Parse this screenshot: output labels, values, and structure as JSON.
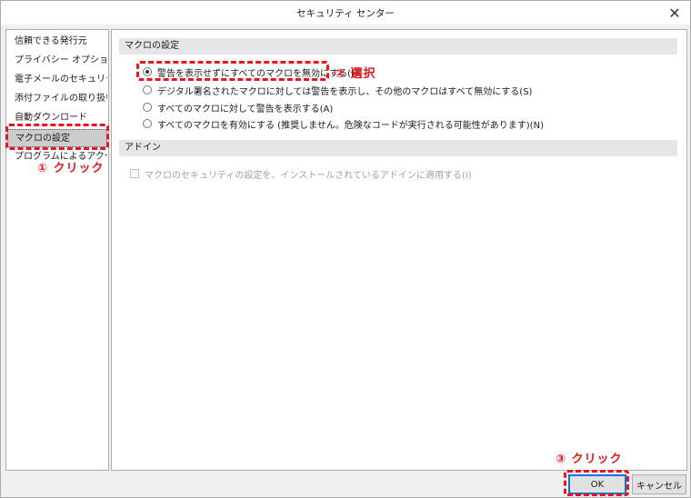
{
  "window": {
    "title": "セキュリティ センター",
    "close_glyph": "✕"
  },
  "sidebar": {
    "items": [
      {
        "label": "信頼できる発行元"
      },
      {
        "label": "プライバシー オプション"
      },
      {
        "label": "電子メールのセキュリティ"
      },
      {
        "label": "添付ファイルの取り扱い"
      },
      {
        "label": "自動ダウンロード"
      },
      {
        "label": "マクロの設定",
        "selected": true
      },
      {
        "label": "プログラムによるアクセス"
      }
    ]
  },
  "macro_section": {
    "header": "マクロの設定",
    "options": [
      {
        "label": "警告を表示せずにすべてのマクロを無効にする(M)",
        "checked": true
      },
      {
        "label": "デジタル署名されたマクロに対しては警告を表示し、その他のマクロはすべて無効にする(S)",
        "checked": false
      },
      {
        "label": "すべてのマクロに対して警告を表示する(A)",
        "checked": false
      },
      {
        "label": "すべてのマクロを有効にする (推奨しません。危険なコードが実行される可能性があります)(N)",
        "checked": false
      }
    ]
  },
  "addin_section": {
    "header": "アドイン",
    "checkbox_label": "マクロのセキュリティの設定を、インストールされているアドインに適用する(I)",
    "checked": false,
    "disabled": true
  },
  "buttons": {
    "ok": "OK",
    "cancel": "キャンセル"
  },
  "annotations": {
    "step1": "① クリック",
    "step2": "② 選択",
    "step3": "③ クリック",
    "color": "#e8141e"
  }
}
